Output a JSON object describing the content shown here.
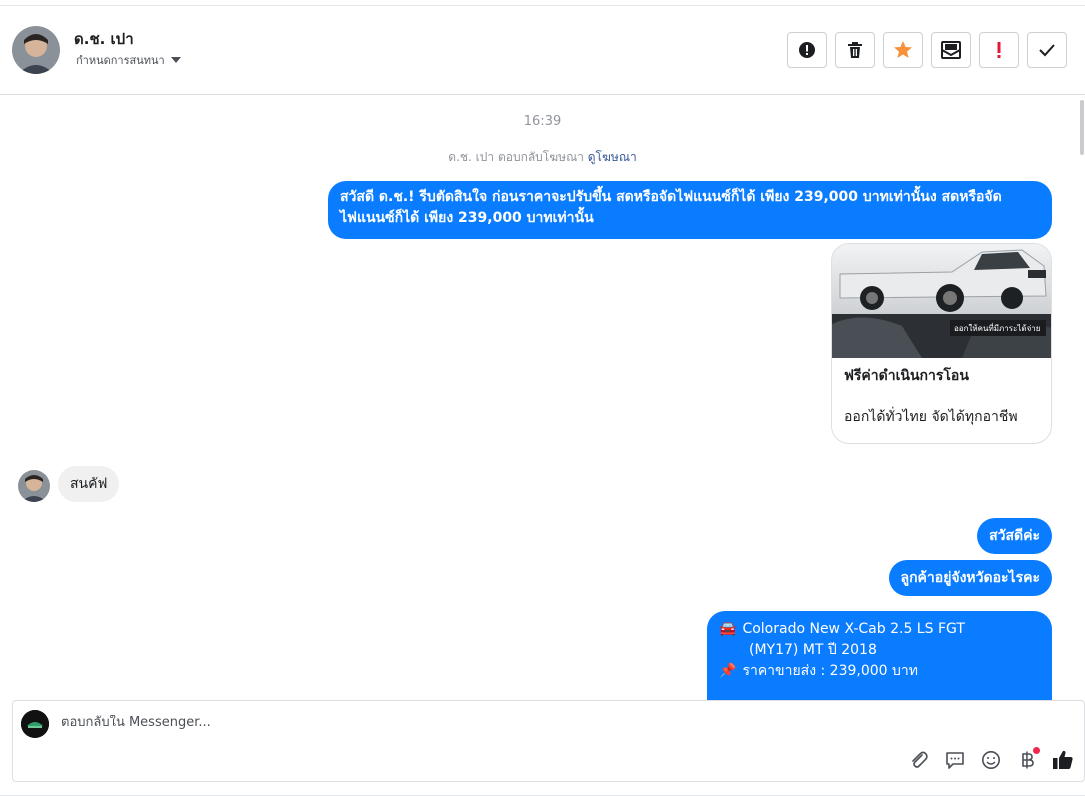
{
  "header": {
    "contact_name": "ด.ช. เปา",
    "assign_label": "กำหนดการสนทนา"
  },
  "thread": {
    "timestamp": "16:39",
    "ad_note": "ด.ช. เปา ตอบกลับโฆษณา",
    "ad_link": "ดูโฆษณา",
    "msg1": "สวัสดี ด.ช.! รีบตัดสินใจ ก่อนราคาจะปรับขึ้น สดหรือจัดไฟแนนซ์ก็ได้  เพียง 239,000 บาทเท่านั้นง สดหรือจัดไฟแนนซ์ก็ได้  เพียง 239,000 บาทเท่านั้น",
    "card": {
      "image_caption": "ออกให้คนที่มีภาระได้จ่าย",
      "title": "ฟรีค่าดำเนินการโอน",
      "subtitle": "ออกได้ทั่วไทย จัดได้ทุกอาชีพ"
    },
    "incoming": "สนคัฟ",
    "msg2": "สวัสดีค่ะ",
    "msg3": "ลูกค้าอยู่จังหวัดอะไรคะ",
    "msg4": {
      "line1_emoji": "🚘",
      "line1": "Colorado New X-Cab 2.5 LS FGT",
      "line2": "(MY17) MT ปี 2018",
      "line3_emoji": "📌",
      "line3": "ราคาขายส่ง : 239,000 บาท"
    }
  },
  "composer": {
    "placeholder": "ตอบกลับใน Messenger..."
  },
  "colors": {
    "bubble_out": "#0a7cff",
    "bubble_in": "#f0f0f0",
    "star": "#f7923a",
    "alert": "#e4163a"
  }
}
